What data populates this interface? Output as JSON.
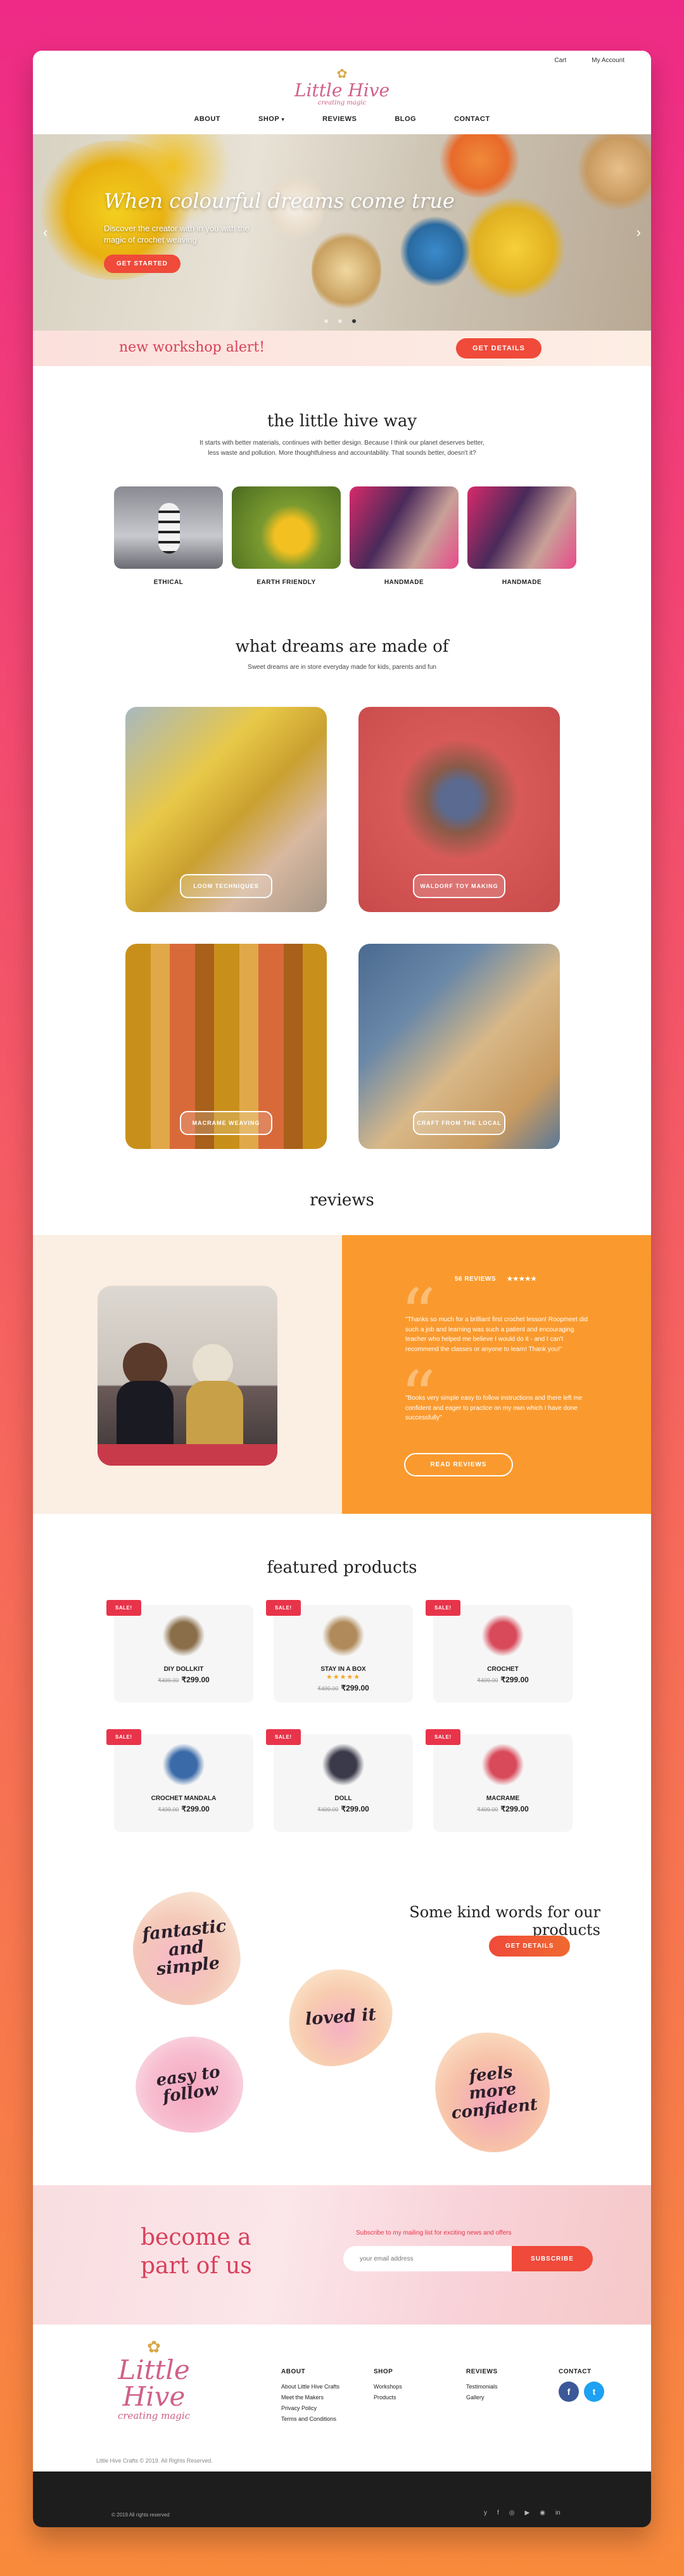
{
  "header": {
    "cart": "Cart",
    "account": "My Account",
    "logo_title": "Little Hive",
    "logo_sub": "creating magic",
    "nav": [
      "ABOUT",
      "SHOP",
      "REVIEWS",
      "BLOG",
      "CONTACT"
    ]
  },
  "hero": {
    "title": "When colourful dreams come true",
    "subtitle": "Discover the creator with in you with the magic of crochet weaving",
    "button": "GET STARTED",
    "arrow_left": "‹",
    "arrow_right": "›",
    "slide_count": 3,
    "active_slide": 3
  },
  "workshop": {
    "text": "new workshop alert!",
    "button": "GET DETAILS"
  },
  "way": {
    "title": "the little hive way",
    "text": "It starts with better materials, continues with better design. Because I think our planet deserves better, less waste and pollution. More thoughtfulness and accountability. That sounds better, doesn't it?",
    "items": [
      "ETHICAL",
      "EARTH FRIENDLY",
      "HANDMADE",
      "HANDMADE"
    ]
  },
  "dreams": {
    "title": "what dreams are made of",
    "subtitle": "Sweet dreams are in store everyday made for kids, parents and fun",
    "items": [
      "LOOM TECHNIQUES",
      "WALDORF TOY MAKING",
      "MACRAME WEAVING",
      "CRAFT FROM THE LOCAL"
    ]
  },
  "reviews": {
    "title": "reviews",
    "count": "56 REVIEWS",
    "stars": "★★★★★",
    "quote1": "\"Thanks so much for a brilliant first crochet lesson! Roopmeet did such a job and learning was such a patient and encouraging teacher who helped me believe I would do it - and I can't recommend the classes or anyone to learn! Thank you!\"",
    "quote2": "\"Books very simple easy to follow instructions and there left me confident and eager to practice on my own which I have done successfully\"",
    "button": "READ REVIEWS"
  },
  "products": {
    "title": "featured products",
    "sale": "SALE!",
    "items": [
      {
        "name": "DIY DOLLKIT",
        "old": "₹499.00",
        "new": "₹299.00",
        "stars": "",
        "color": "#8a6e4a"
      },
      {
        "name": "STAY IN A BOX",
        "old": "₹499.00",
        "new": "₹299.00",
        "stars": "★★★★★",
        "color": "#b08a5a"
      },
      {
        "name": "CROCHET",
        "old": "₹499.00",
        "new": "₹299.00",
        "stars": "",
        "color": "#d84a5a"
      },
      {
        "name": "CROCHET MANDALA",
        "old": "₹499.00",
        "new": "₹299.00",
        "stars": "",
        "color": "#3a6aa8"
      },
      {
        "name": "DOLL",
        "old": "₹499.00",
        "new": "₹299.00",
        "stars": "",
        "color": "#3a3a4a"
      },
      {
        "name": "MACRAME",
        "old": "₹499.00",
        "new": "₹299.00",
        "stars": "",
        "color": "#d84a5a"
      }
    ]
  },
  "kind_words": {
    "title": "Some kind words for our products",
    "button": "GET DETAILS",
    "words": [
      "fantastic and simple",
      "loved it",
      "easy to follow",
      "feels more confident"
    ]
  },
  "become": {
    "text": "become a part of us",
    "label": "Subscribe to my mailing list for exciting news and offers",
    "placeholder": "your email address",
    "button": "SUBSCRIBE"
  },
  "footer": {
    "about_title": "ABOUT",
    "about_links": [
      "About Little Hive Crafts",
      "Meet the Makers",
      "Privacy Policy",
      "Terms and Conditions"
    ],
    "shop_title": "SHOP",
    "shop_links": [
      "Workshops",
      "Products"
    ],
    "reviews_title": "REVIEWS",
    "reviews_links": [
      "Testimonials",
      "Gallery"
    ],
    "contact_title": "CONTACT",
    "facebook": "f",
    "twitter": "t",
    "copyright": "Little Hive Crafts © 2019. All Rights Reserved.",
    "bottom_copy": "© 2019 All rights reserved",
    "social_icons": [
      "y",
      "f",
      "◎",
      "▶",
      "◉",
      "in"
    ]
  },
  "colors": {
    "accent": "#ef4a3a",
    "brand_pink": "#d0608a",
    "orange": "#fa9a2e",
    "cream": "#fbeee2"
  }
}
